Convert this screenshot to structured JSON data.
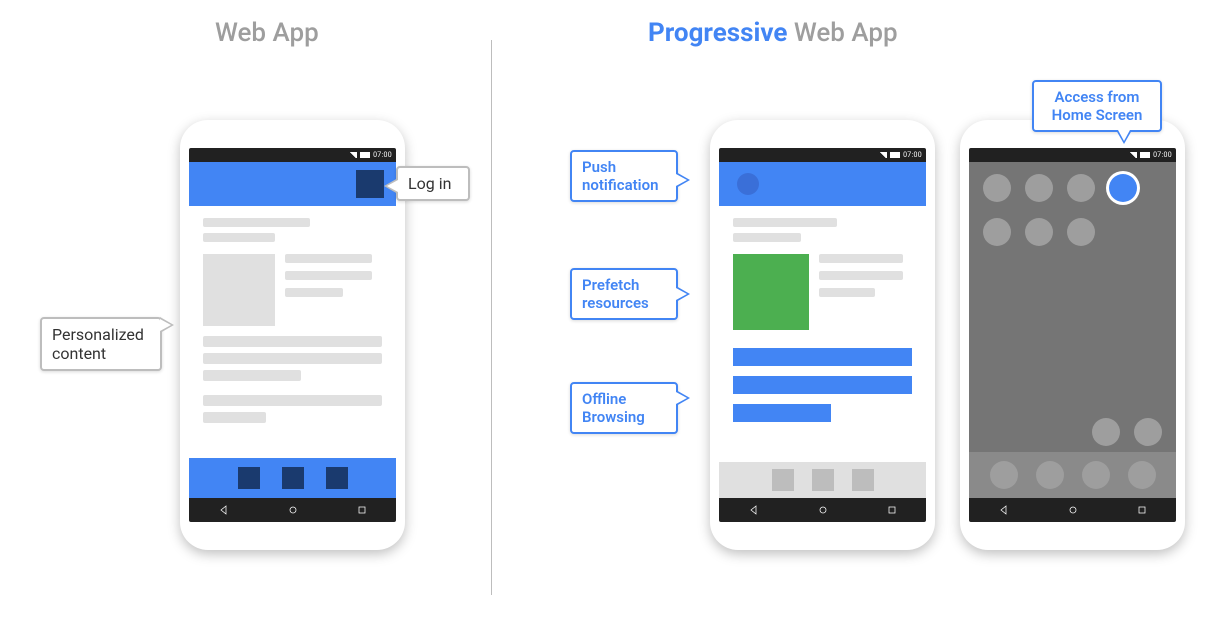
{
  "titles": {
    "left": "Web App",
    "right_accent": "Progressive",
    "right_rest": " Web App"
  },
  "status": {
    "time": "07:00"
  },
  "callouts": {
    "login": "Log in",
    "personalized": "Personalized content",
    "push": "Push notification",
    "prefetch": "Prefetch resources",
    "offline": "Offline Browsing",
    "home": "Access from Home Screen"
  }
}
